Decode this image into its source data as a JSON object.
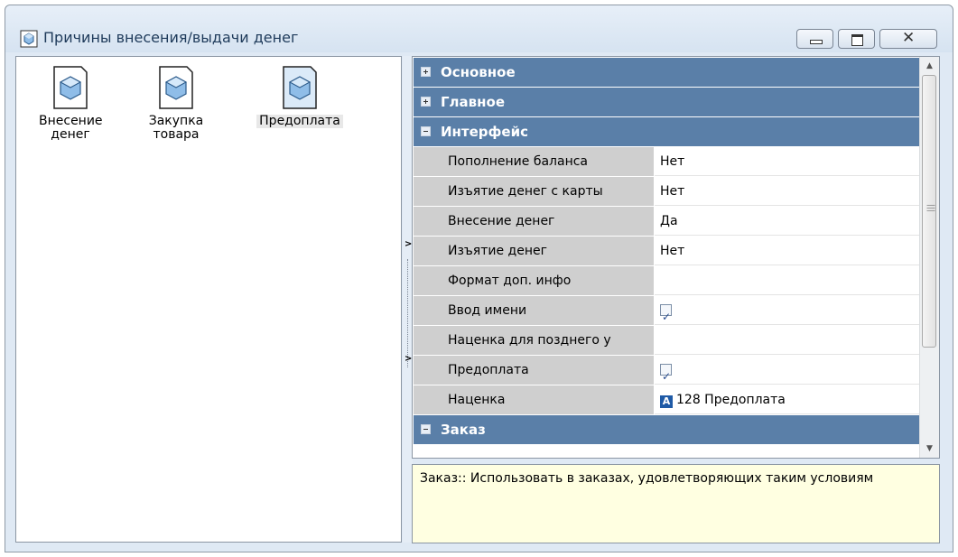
{
  "window": {
    "title": "Причины внесения/выдачи денег"
  },
  "objects": [
    {
      "label": "Внесение денег",
      "selected": false
    },
    {
      "label": "Закупка товара",
      "selected": false
    },
    {
      "label": "Предоплата",
      "selected": true
    }
  ],
  "grid": {
    "categories": {
      "basic": "Основное",
      "main": "Главное",
      "interface": "Интерфейс",
      "order": "Заказ"
    },
    "rows": [
      {
        "name": "Пополнение баланса",
        "value": "Нет"
      },
      {
        "name": "Изъятие денег с карты",
        "value": "Нет"
      },
      {
        "name": "Внесение денег",
        "value": "Да"
      },
      {
        "name": "Изъятие денег",
        "value": "Нет"
      },
      {
        "name": "Формат доп. инфо",
        "value": ""
      },
      {
        "name": "Ввод имени",
        "checked": true
      },
      {
        "name": "Наценка для позднего у",
        "value": ""
      },
      {
        "name": "Предоплата",
        "checked": true
      },
      {
        "name": "Наценка",
        "icon_letter": "A",
        "value": "128 Предоплата"
      }
    ]
  },
  "description": "Заказ:: Использовать в заказах, удовлетворяющих таким условиям",
  "colors": {
    "category_bg": "#5a7fa8",
    "description_bg": "#ffffe1",
    "property_name_bg": "#cfcfcf"
  }
}
